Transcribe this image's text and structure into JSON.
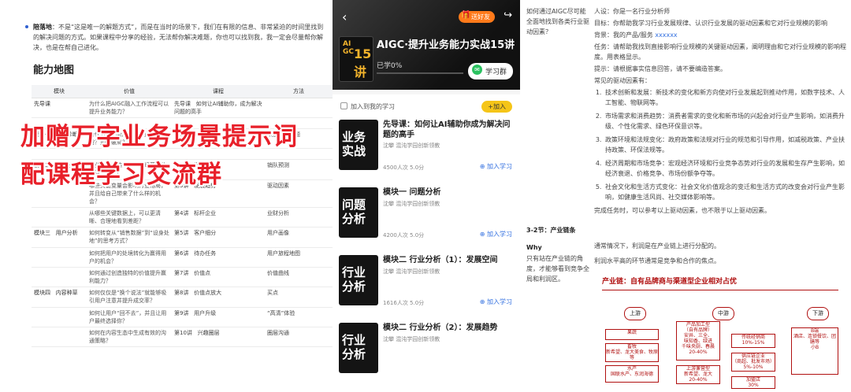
{
  "left": {
    "bullet_bold": "陪落地",
    "bullet_text": "：不是“这是唯一的解题方式”，而是在当时的场景下，我们在有限的信息、非常紧迫的时间里找到的解决问题的方式。如果课程中分享的经验，无法帮你解决难题，你也可以找到我，我一定会尽量帮你解决，也是在帮自己进化。",
    "heading": "能力地图",
    "table": {
      "headers": [
        "模块",
        "价值",
        "课程",
        "方法"
      ],
      "rows": [
        {
          "mod": "先导课",
          "mod2": "",
          "val": "为什么把AIGC融入工作流程可以提升业务能力？",
          "no": "先导课",
          "course": "如何让AI辅助你，成为解决问题的高手",
          "method": ""
        },
        {
          "mod": "",
          "mod2": "",
          "val": "",
          "no": "",
          "course": "",
          "method": ""
        },
        {
          "mod": "模块一",
          "mod2": "问题诊断",
          "val": "为什么我们会陷入无休止的新需？如何破局？",
          "no": "第1讲",
          "course": "问题分析",
          "method": "识别基本问题"
        },
        {
          "mod": "",
          "mod2": "",
          "val": "",
          "no": "",
          "course": "",
          "method": ""
        },
        {
          "mod": "模块二",
          "mod2": "行业分析",
          "val": "行业空间和格局对企业经营有什么直接影响？",
          "no": "第2讲",
          "course": "发展空间",
          "method": "销队预测"
        },
        {
          "mod": "",
          "mod2": "",
          "val": "哪些关键变量会影响行业格局，并且给自己带来了什么样的机会？",
          "no": "第3讲",
          "course": "发展趋势",
          "method": "驱动因素"
        },
        {
          "mod": "",
          "mod2": "",
          "val": "从哪些关键数据上，可以更清晰、合理地看到差距？",
          "no": "第4讲",
          "course": "标杆企业",
          "method": "业财分析"
        },
        {
          "mod": "模块三",
          "mod2": "用户分析",
          "val": "如何转变从“销售数据”到“设身处地”的思考方式？",
          "no": "第5讲",
          "course": "客户细分",
          "method": "用户画像"
        },
        {
          "mod": "",
          "mod2": "",
          "val": "如何把用户的处境转化为赢得用户的机会？",
          "no": "第6讲",
          "course": "待办任务",
          "method": "用户旅程地图"
        },
        {
          "mod": "",
          "mod2": "",
          "val": "如何通过创造独特的价值提升赢利能力？",
          "no": "第7讲",
          "course": "价值点",
          "method": "价值曲线"
        },
        {
          "mod": "模块四",
          "mod2": "内容种草",
          "val": "如何仅仅是“换个说法”就能够吸引用户注意并提升成交率？",
          "no": "第8讲",
          "course": "价值点放大",
          "method": "买点"
        },
        {
          "mod": "",
          "mod2": "",
          "val": "如何让用户“回不去”，并且让用户最终选择你？",
          "no": "第9讲",
          "course": "用户升级",
          "method": "“高清”体验"
        },
        {
          "mod": "",
          "mod2": "",
          "val": "如何在内容生态中生成有效的沟通策略？",
          "no": "第10讲",
          "course": "兴趣圈层",
          "method": "圈层沟通"
        }
      ]
    },
    "overlay_line1": "加赠万字业务场景提示词",
    "overlay_line2": "配课程学习交流群"
  },
  "mid": {
    "promo": "送好友",
    "cover_top": "AI\nGC",
    "cover_num": "15讲",
    "course_title": "AIGC·提升业务能力实战15讲",
    "progress_label": "已学0%",
    "progress_value": 0,
    "group_button": "学习群",
    "add_to_study": "加入到我的学习",
    "add_button": "+加入",
    "lessons": [
      {
        "thumb1": "业务",
        "thumb2": "实战",
        "title": "先导课：如何让AI辅助你成为解决问题的高手",
        "author": "沈攀 混沌学园创新领教",
        "meta": "4500人次 5.0分",
        "join": "加入学习"
      },
      {
        "thumb1": "问题",
        "thumb2": "分析",
        "title": "模块一 问题分析",
        "author": "沈攀 混沌学园创新领教",
        "meta": "4200人次 5.0分",
        "join": "加入学习"
      },
      {
        "thumb1": "行业",
        "thumb2": "分析",
        "title": "模块二 行业分析（1）：发展空间",
        "author": "沈攀 混沌学园创新领教",
        "meta": "1616人次 5.0分",
        "join": "加入学习"
      },
      {
        "thumb1": "行业",
        "thumb2": "分析",
        "title": "模块二 行业分析（2）：发展趋势",
        "author": "沈攀 混沌学园创新领教",
        "meta": "",
        "join": ""
      }
    ]
  },
  "right": {
    "question": "如何通过AIGC尽可能全面地找到各类行业驱动因素？",
    "role": "人设：你是一名行业分析师",
    "goal": "目标：你帮助我学习行业发展规律、认识行业发展的驱动因素和它对行业规模的影响",
    "background_prefix": "背景：我的产品/服务",
    "background_highlight": "xxxxxx",
    "task": "任务：请帮助我找到直接影响行业规模的关键驱动因素，阐明理由和它对行业规模的影响程度。用表格显示。",
    "hint": "提示：请根据事实信息回答，请不要编造答案。",
    "common_title": "常见的驱动因素有：",
    "factors": [
      "技术创新和发展：新技术的变化和新方向使对行业发展起到推动作用，如数字技术、人工智能、物联网等。",
      "市场需求和消费趋势：消费者需求的变化和新市场的兴起会对行业产生影响，如消费升级、个性化需求、绿色环保意识等。",
      "政策环境和法规变化：政府政策和法规对行业的规范和引导作用，如减税政策、产业扶持政策、环保法规等。",
      "经济周期和市场竞争：宏观经济环境和行业竞争态势对行业的发展和生存产生影响，如经济衰退、价格竞争、市场份额争夺等。",
      "社会文化和生活方式变化：社会文化价值观念的变迁和生活方式的改变会对行业产生影响，如健康生活风尚、社交媒体影响等。"
    ],
    "finish": "完成任务时，可以参考以上驱动因素，也不限于以上驱动因素。",
    "section": "3-2节：产业链条",
    "why_label": "Why",
    "why_text": "只有站在产业链的角度，才能够看到竞争全局和利润区。",
    "answer1": "通常情况下，利润是在产业链上进行分配的。",
    "answer2": "利润水平高的环节通常是竞争和合作的焦点。",
    "chain_title": "产业链：自有品牌商与渠道型企业相对占优",
    "stages": [
      "上游",
      "中游",
      "下游"
    ],
    "boxes": [
      "果蔬",
      "畜牧\n新希望、龙大美食、牧原等",
      "水产\n国联水产、东润海德",
      "产品加工型\n（自有品牌）\n安井、三全、\n味知香、绿进\n千味央厨、春晨\n20-40%",
      "上游兼营型\n新希望、龙大\n20-40%",
      "传统经销商\n10%-15%",
      "供应链企业\n（商超、批发市场）\n5%-10%",
      "加盟店\n30%",
      "B端\n酒店、连锁餐饮、团膳等\n小B"
    ]
  }
}
